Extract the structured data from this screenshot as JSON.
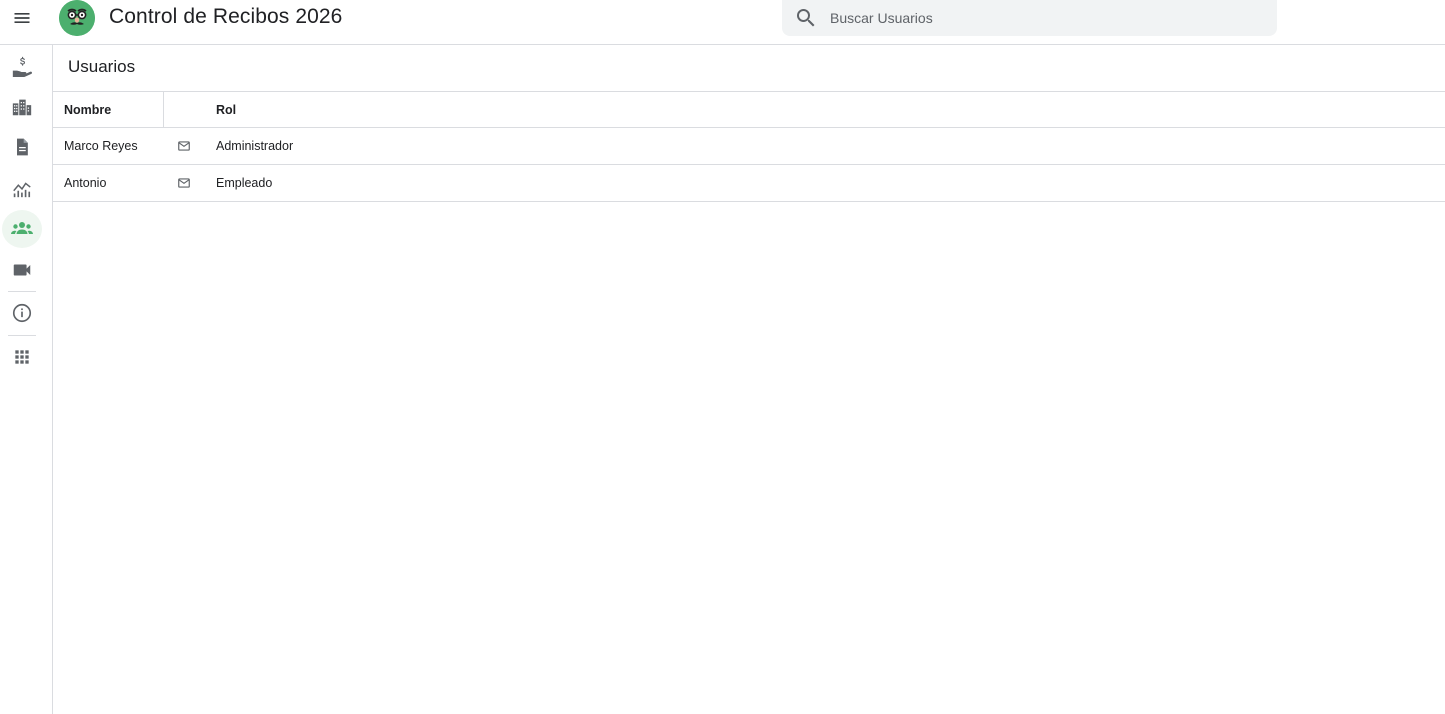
{
  "header": {
    "title": "Control de Recibos 2026",
    "menu_icon": "menu-icon",
    "logo_icon": "disguise-face-logo"
  },
  "search": {
    "placeholder": "Buscar Usuarios",
    "value": "",
    "icon": "search-icon"
  },
  "sidebar": {
    "items": [
      {
        "icon": "payment-hand-icon",
        "active": false
      },
      {
        "icon": "buildings-icon",
        "active": false
      },
      {
        "icon": "document-icon",
        "active": false
      },
      {
        "icon": "analytics-chart-icon",
        "active": false
      },
      {
        "icon": "group-icon",
        "active": true
      },
      {
        "icon": "video-camera-icon",
        "active": false
      },
      {
        "icon": "info-icon",
        "active": false
      },
      {
        "icon": "apps-grid-icon",
        "active": false
      }
    ]
  },
  "main": {
    "title": "Usuarios",
    "table": {
      "columns": {
        "name": "Nombre",
        "role": "Rol"
      },
      "rows": [
        {
          "name": "Marco Reyes",
          "role": "Administrador",
          "action_icon": "mail-icon"
        },
        {
          "name": "Antonio",
          "role": "Empleado",
          "action_icon": "mail-icon"
        }
      ]
    }
  },
  "colors": {
    "accent": "#4caf6e",
    "active_nav_bg": "#eef6f0",
    "divider": "#dadce0",
    "icon_gray": "#5f6368"
  }
}
